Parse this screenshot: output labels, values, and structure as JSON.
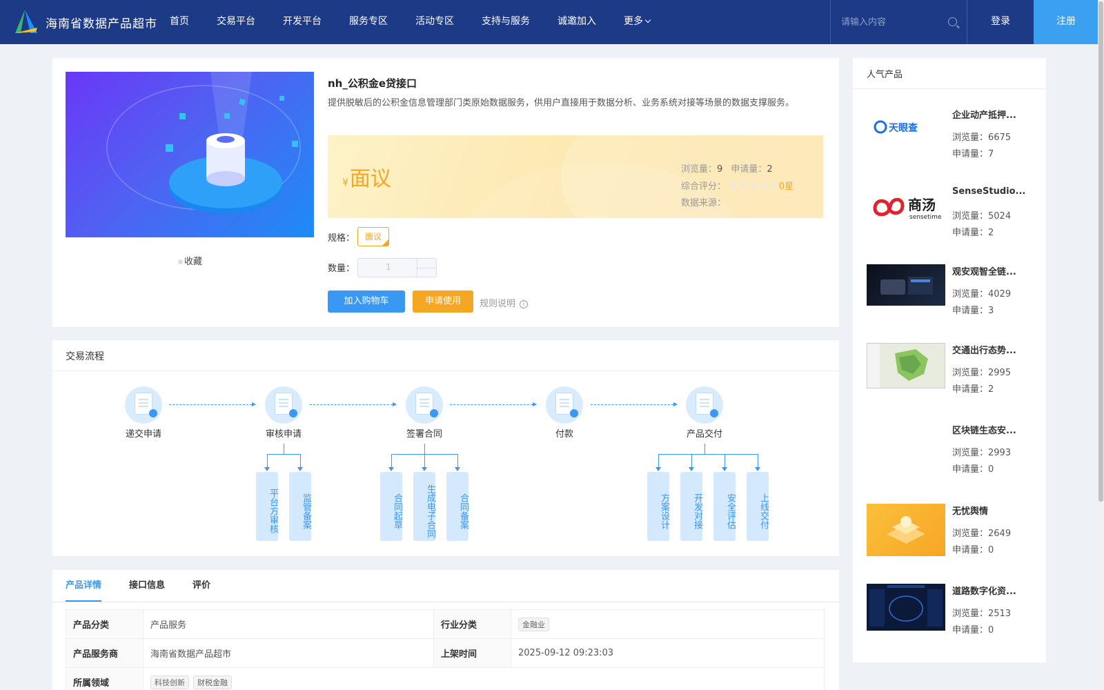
{
  "header": {
    "site_title": "海南省数据产品超市",
    "nav": [
      "首页",
      "交易平台",
      "开发平台",
      "服务专区",
      "活动专区",
      "支持与服务",
      "诚邀加入",
      "更多"
    ],
    "search_placeholder": "请输入内容",
    "login": "登录",
    "register": "注册"
  },
  "product": {
    "name": "nh_公积金e贷接口",
    "description": "提供脱敏后的公积金信息管理部门类原始数据服务，供用户直接用于数据分析、业务系统对接等场景的数据支撑服务。",
    "favorite": "收藏",
    "price_symbol": "¥",
    "price": "面议",
    "views_label": "浏览量：",
    "views": "9",
    "applies_label": "申请量：",
    "applies": "2",
    "rating_label": "综合评分：",
    "rating_text": "0星",
    "rating": 0,
    "source_label": "数据来源：",
    "spec_label": "规格：",
    "spec_value": "面议",
    "qty_label": "数量：",
    "qty_value": "1",
    "add_cart": "加入购物车",
    "apply": "申请使用",
    "rules": "规则说明"
  },
  "flow": {
    "title": "交易流程",
    "steps": [
      "递交申请",
      "审核申请",
      "签署合同",
      "付款",
      "产品交付"
    ],
    "review_subs": [
      "平台方审核",
      "监管备案"
    ],
    "contract_subs": [
      "合同起草",
      "生成电子合同",
      "合同备案"
    ],
    "delivery_subs": [
      "方案设计",
      "开发对接",
      "安全评估",
      "上线交付"
    ]
  },
  "details": {
    "tabs": [
      "产品详情",
      "接口信息",
      "评价"
    ],
    "rows": {
      "category_label": "产品分类",
      "category": "产品服务",
      "industry_label": "行业分类",
      "industry": "金融业",
      "provider_label": "产品服务商",
      "provider": "海南省数据产品超市",
      "listed_label": "上架时间",
      "listed": "2025-09-12 09:23:03",
      "domain_label": "所属领域",
      "domains": [
        "科技创新",
        "财税金融"
      ]
    }
  },
  "sidebar": {
    "title": "人气产品",
    "views_label": "浏览量：",
    "applies_label": "申请量：",
    "items": [
      {
        "name": "企业动产抵押...",
        "views": "6675",
        "applies": "7",
        "thumb": "tianyancha-logo"
      },
      {
        "name": "SenseStudio...",
        "views": "5024",
        "applies": "2",
        "thumb": "sensetime-logo"
      },
      {
        "name": "观安观智全链...",
        "views": "4029",
        "applies": "3",
        "thumb": "device-photo"
      },
      {
        "name": "交通出行态势...",
        "views": "2995",
        "applies": "2",
        "thumb": "map-screenshot"
      },
      {
        "name": "区块链生态安...",
        "views": "2993",
        "applies": "0",
        "thumb": ""
      },
      {
        "name": "无忧舆情",
        "views": "2649",
        "applies": "0",
        "thumb": "orange-banner"
      },
      {
        "name": "道路数字化资...",
        "views": "2513",
        "applies": "0",
        "thumb": "dashboard-screenshot"
      }
    ],
    "logo_text": {
      "tianyancha": "天眼查",
      "sensetime": "商汤",
      "sensetime_sub": "sensetime"
    }
  },
  "colors": {
    "header": "#1d3a86",
    "accent": "#3a98f2",
    "orange": "#f5a623"
  }
}
